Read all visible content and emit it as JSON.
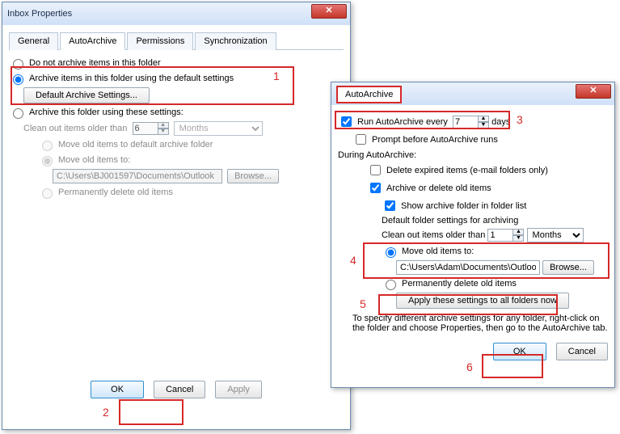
{
  "left": {
    "title": "Inbox Properties",
    "tabs": [
      "General",
      "AutoArchive",
      "Permissions",
      "Synchronization"
    ],
    "activeTab": "AutoArchive",
    "opt_noarchive": "Do not archive items in this folder",
    "opt_default": "Archive items in this folder using the default settings",
    "btn_defarch": "Default Archive Settings...",
    "opt_these": "Archive this folder using these settings:",
    "clean_label": "Clean out items older than",
    "clean_n": "6",
    "clean_unit": "Months",
    "opt_movedef": "Move old items to default archive folder",
    "opt_moveto": "Move old items to:",
    "path": "C:\\Users\\BJ001597\\Documents\\Outlook",
    "browse": "Browse...",
    "opt_permdel": "Permanently delete old items",
    "ok": "OK",
    "cancel": "Cancel",
    "apply": "Apply"
  },
  "right": {
    "tab": "AutoArchive",
    "run_label": "Run AutoArchive every",
    "run_n": "7",
    "run_unit": "days",
    "prompt": "Prompt before AutoArchive runs",
    "during": "During AutoArchive:",
    "del_exp": "Delete expired items (e-mail folders only)",
    "arch_del": "Archive or delete old items",
    "show_folder": "Show archive folder in folder list",
    "def_head": "Default folder settings for archiving",
    "clean_label": "Clean out items older than",
    "clean_n": "1",
    "clean_unit": "Months",
    "opt_moveto": "Move old items to:",
    "path": "C:\\Users\\Adam\\Documents\\Outlook",
    "browse": "Browse...",
    "opt_permdel": "Permanently delete old items",
    "applyall": "Apply these settings to all folders now",
    "help": "To specify different archive settings for any folder, right-click on the folder and choose Properties, then go to the AutoArchive tab.",
    "ok": "OK",
    "cancel": "Cancel"
  },
  "ann": {
    "1": "1",
    "2": "2",
    "3": "3",
    "4": "4",
    "5": "5",
    "6": "6"
  }
}
